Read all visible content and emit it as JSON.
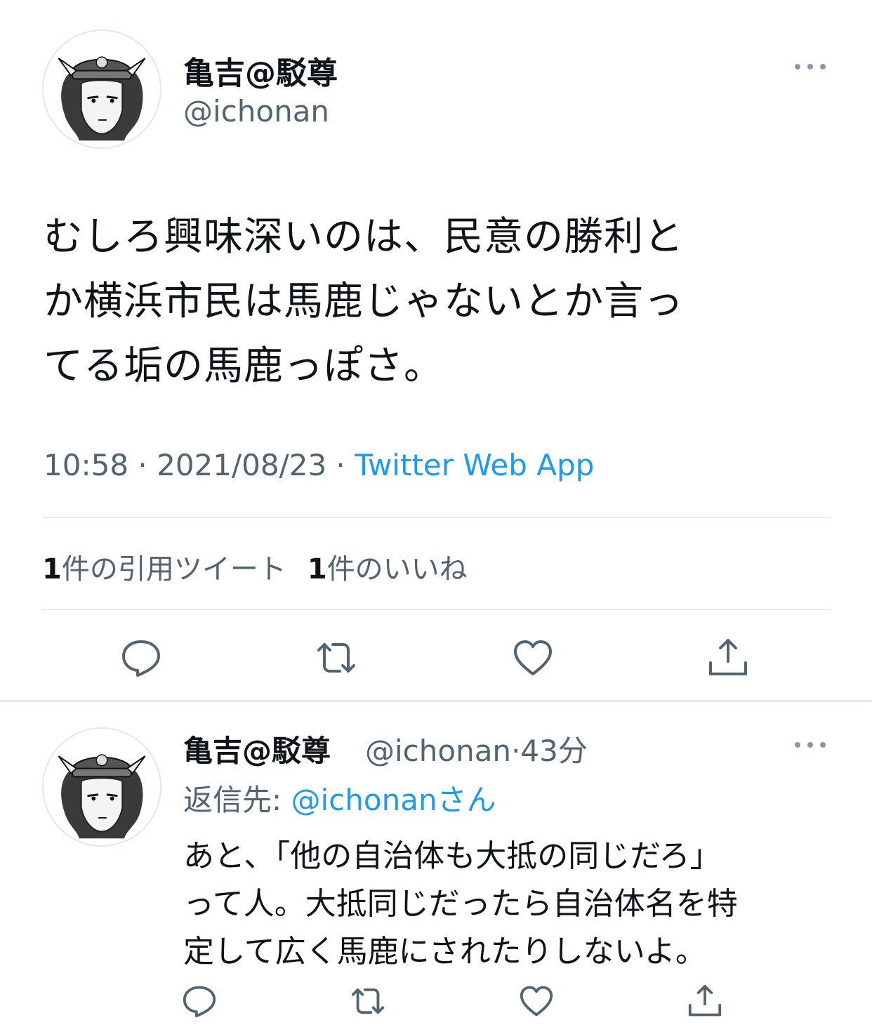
{
  "main_tweet": {
    "display_name": "亀吉@駁尊",
    "handle": "@ichonan",
    "text_lines": [
      "むしろ興味深いのは、民意の勝利と",
      "か横浜市民は馬鹿じゃないとか言っ",
      "てる垢の馬鹿っぽさ。"
    ],
    "time": "10:58",
    "date": "2021/08/23",
    "separator": " · ",
    "source": "Twitter Web App",
    "quote_count": "1",
    "quote_label": "件の引用ツイート",
    "like_count": "1",
    "like_label": "件のいいね"
  },
  "reply_tweet": {
    "display_name": "亀吉@駁尊",
    "handle": "@ichonan",
    "separator": "·",
    "time_ago": "43分",
    "reply_to_label": "返信先: ",
    "reply_to_handle": "@ichonanさん",
    "text_lines": [
      "あと、「他の自治体も大抵の同じだろ」",
      "って人。大抵同じだったら自治体名を特",
      "定して広く馬鹿にされたりしないよ。"
    ]
  },
  "icons": {
    "reply": "reply-icon",
    "retweet": "retweet-icon",
    "like": "heart-icon",
    "share": "share-icon",
    "more": "more-icon"
  },
  "colors": {
    "accent": "#1d9bf0",
    "secondary_text": "#536471",
    "icon_gray": "#536471",
    "divider": "#e6ecf0"
  }
}
